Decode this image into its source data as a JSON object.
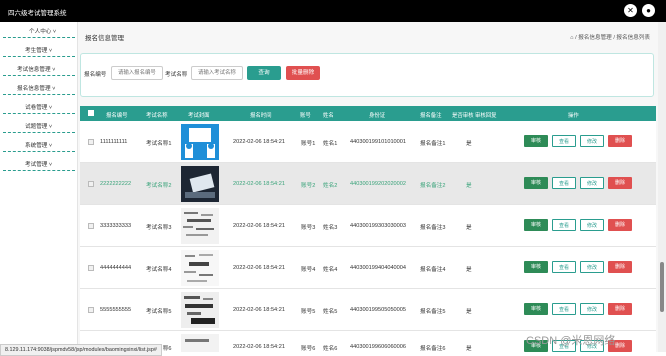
{
  "app": {
    "title": "四六级考试管理系统"
  },
  "header": {
    "close_icon": "close-icon",
    "avatar_icon": "user-avatar-icon"
  },
  "sidebar": {
    "items": [
      {
        "label": "个人中心 ˅"
      },
      {
        "label": "考生管理 ˅"
      },
      {
        "label": "考试信息管理 ˅"
      },
      {
        "label": "报名信息管理 ˅"
      },
      {
        "label": "试卷管理 ˅"
      },
      {
        "label": "试题管理 ˅"
      },
      {
        "label": "系统管理 ˅"
      },
      {
        "label": "考试管理 ˅"
      }
    ]
  },
  "main": {
    "page_title": "报名信息管理",
    "breadcrumb": "⌂ / 报名信息管理 / 报名信息列表"
  },
  "search": {
    "field1_label": "报名编号",
    "field1_placeholder": "请输入报名编号",
    "field2_label": "考试名称",
    "field2_placeholder": "请输入考试名称",
    "search_button": "查询",
    "batch_delete_button": "批量删除",
    "search_color": "#2a9d8f",
    "delete_color": "#e05050"
  },
  "table": {
    "headers": [
      "报名编号",
      "考试名称",
      "考试封面",
      "报名时间",
      "账号",
      "姓名",
      "身份证",
      "报名备注",
      "是否审核",
      "审核回复",
      "操作"
    ],
    "actions": {
      "review": "审核",
      "view": "查看",
      "edit": "修改",
      "delete": "删除"
    },
    "rows": [
      {
        "id": "1111111111",
        "exam": "考试名称1",
        "time": "2022-02-06 18:54:21",
        "account": "账号1",
        "name": "姓名1",
        "idcard": "440300199101010001",
        "remark": "报名备注1",
        "audited": "是"
      },
      {
        "id": "2222222222",
        "exam": "考试名称2",
        "time": "2022-02-06 18:54:21",
        "account": "账号2",
        "name": "姓名2",
        "idcard": "440300199202020002",
        "remark": "报名备注2",
        "audited": "是"
      },
      {
        "id": "3333333333",
        "exam": "考试名称3",
        "time": "2022-02-06 18:54:21",
        "account": "账号3",
        "name": "姓名3",
        "idcard": "440300199303030003",
        "remark": "报名备注3",
        "audited": "是"
      },
      {
        "id": "4444444444",
        "exam": "考试名称4",
        "time": "2022-02-06 18:54:21",
        "account": "账号4",
        "name": "姓名4",
        "idcard": "440300199404040004",
        "remark": "报名备注4",
        "audited": "是"
      },
      {
        "id": "5555555555",
        "exam": "考试名称5",
        "time": "2022-02-06 18:54:21",
        "account": "账号5",
        "name": "姓名5",
        "idcard": "440300199505050005",
        "remark": "报名备注5",
        "audited": "是"
      },
      {
        "id": "6666666666",
        "exam": "考试名称6",
        "time": "2022-02-06 18:54:21",
        "account": "账号6",
        "name": "姓名6",
        "idcard": "440300199606060006",
        "remark": "报名备注6",
        "audited": "是"
      }
    ]
  },
  "status_bar": {
    "url": "8.129.11.174:9038/jspmdv58/jsp/modules/baomingxinxi/list.jsp#"
  },
  "watermark": "CSDN @米恩网络"
}
